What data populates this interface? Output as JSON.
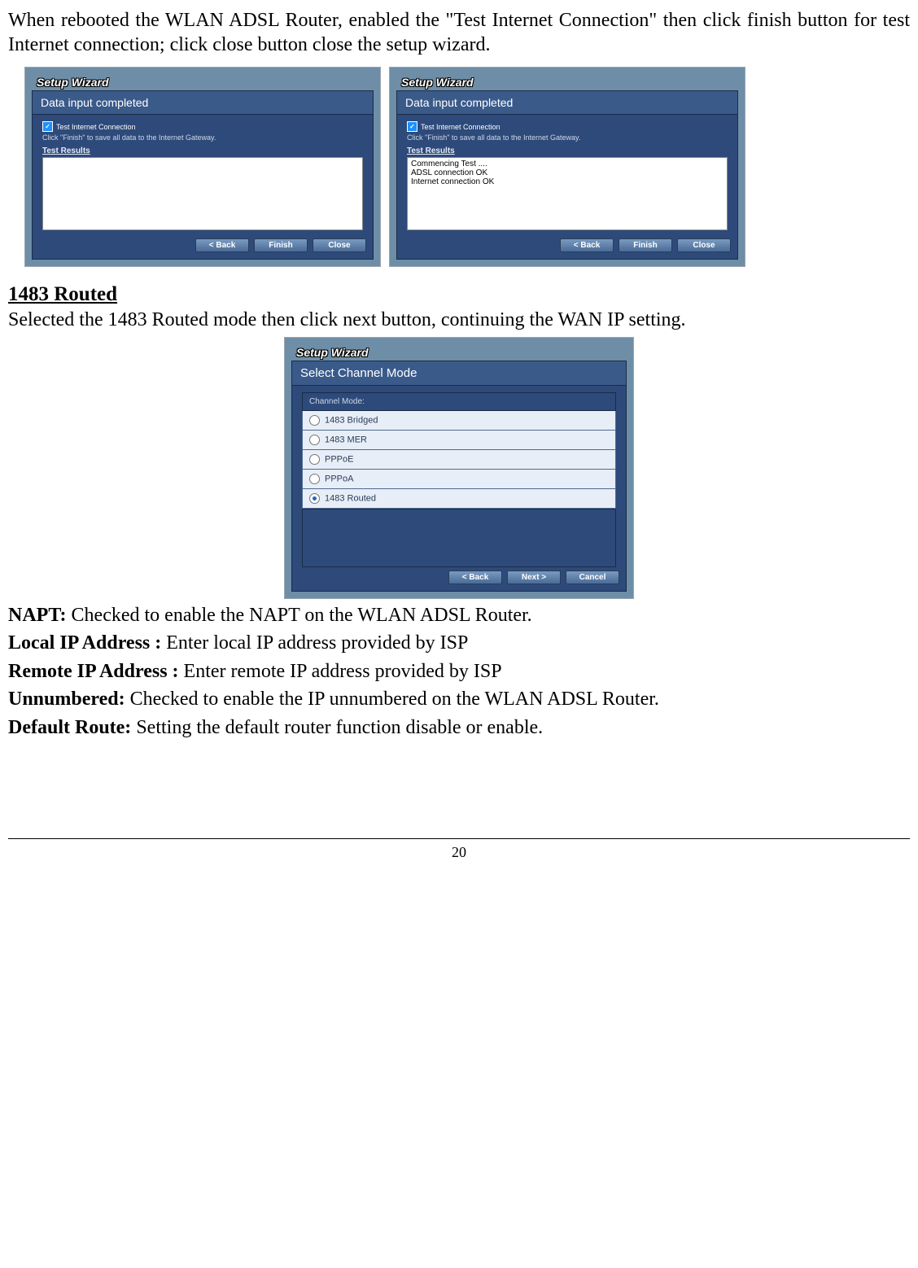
{
  "paragraph1": "When rebooted the WLAN ADSL Router, enabled the \"Test Internet Connection\" then click finish button for test Internet connection; click close button close the setup wizard.",
  "panelL": {
    "windowTitle": "Setup Wizard",
    "header": "Data input completed",
    "chkLabel": "Test Internet Connection",
    "hint": "Click \"Finish\" to save all data to the Internet Gateway.",
    "resultsLabel": "Test Results",
    "resultsBody": "",
    "btnBack": "< Back",
    "btnFinish": "Finish",
    "btnClose": "Close"
  },
  "panelR": {
    "windowTitle": "Setup Wizard",
    "header": "Data input completed",
    "chkLabel": "Test Internet Connection",
    "hint": "Click \"Finish\" to save all data to the Internet Gateway.",
    "resultsLabel": "Test Results",
    "resultsBody": "Commencing Test ....\nADSL connection OK\nInternet connection OK",
    "btnBack": "< Back",
    "btnFinish": "Finish",
    "btnClose": "Close"
  },
  "section2": {
    "title": "1483 Routed",
    "intro": "Selected the 1483 Routed mode then click next button, continuing the WAN IP setting."
  },
  "panelC": {
    "windowTitle": "Setup Wizard",
    "header": "Select Channel Mode",
    "groupLabel": "Channel Mode:",
    "options": [
      "1483 Bridged",
      "1483 MER",
      "PPPoE",
      "PPPoA",
      "1483 Routed"
    ],
    "selectedIndex": 4,
    "btnBack": "< Back",
    "btnNext": "Next >",
    "btnCancel": "Cancel"
  },
  "defs": {
    "naptLabel": "NAPT:",
    "naptText": " Checked to enable the NAPT on the WLAN ADSL Router.",
    "lipLabel": "Local IP Address :",
    "lipText": " Enter local IP address provided by ISP",
    "ripLabel": "Remote IP Address :",
    "ripText": " Enter remote IP address provided by ISP",
    "unLabel": "Unnumbered:",
    "unText": " Checked to enable the IP unnumbered on the WLAN ADSL Router.",
    "drLabel": "Default Route:",
    "drText": " Setting the default router function disable or enable."
  },
  "pageNumber": "20"
}
